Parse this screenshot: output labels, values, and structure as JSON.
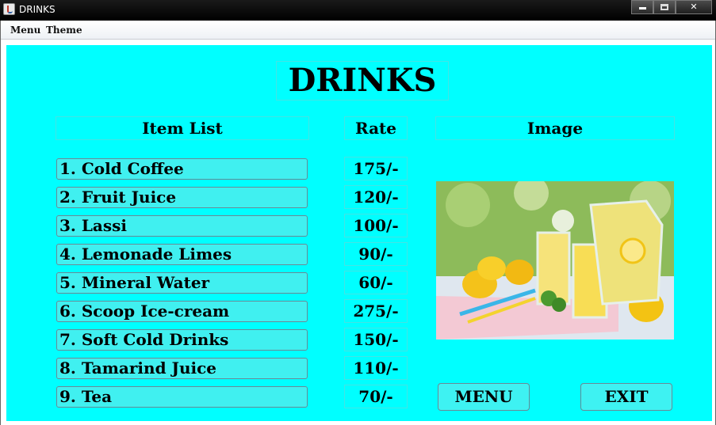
{
  "window": {
    "title": "DRINKS"
  },
  "menubar": {
    "items": [
      "Menu",
      "Theme"
    ]
  },
  "page": {
    "title": "DRINKS",
    "headers": {
      "items": "Item List",
      "rate": "Rate",
      "image": "Image"
    },
    "items": [
      {
        "name": "1. Cold Coffee",
        "rate": "175/-"
      },
      {
        "name": "2. Fruit Juice",
        "rate": "120/-"
      },
      {
        "name": "3. Lassi",
        "rate": "100/-"
      },
      {
        "name": "4. Lemonade Limes",
        "rate": "90/-"
      },
      {
        "name": "5. Mineral Water",
        "rate": "60/-"
      },
      {
        "name": "6. Scoop Ice-cream",
        "rate": "275/-"
      },
      {
        "name": "7. Soft Cold Drinks",
        "rate": "150/-"
      },
      {
        "name": "8. Tamarind Juice",
        "rate": "110/-"
      },
      {
        "name": "9. Tea",
        "rate": "70/-"
      }
    ],
    "buttons": {
      "menu": "MENU",
      "exit": "EXIT"
    }
  },
  "colors": {
    "background": "#00ffff",
    "item_fill": "#40f0f0"
  }
}
